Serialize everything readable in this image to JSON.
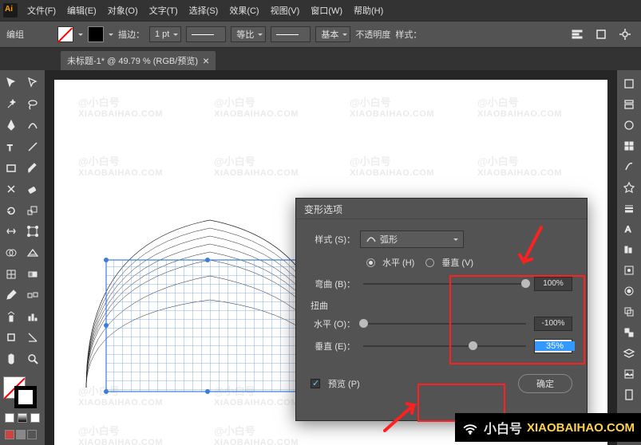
{
  "menu": {
    "file": "文件(F)",
    "edit": "编辑(E)",
    "object": "对象(O)",
    "type": "文字(T)",
    "select": "选择(S)",
    "effect": "效果(C)",
    "view": "视图(V)",
    "window": "窗口(W)",
    "help": "帮助(H)"
  },
  "control": {
    "group_label": "编组",
    "stroke_label": "描边：",
    "stroke_val": "1 pt",
    "dash1": "等比",
    "dash2": "基本",
    "opacity_label": "不透明度",
    "style_label": "样式："
  },
  "tab": {
    "title": "未标题-1* @ 49.79 % (RGB/预览)",
    "close": "×"
  },
  "dialog": {
    "title": "变形选项",
    "style_label": "样式 (S)：",
    "style_value": "弧形",
    "h_label": "水平 (H)",
    "v_label": "垂直 (V)",
    "bend_label": "弯曲 (B)：",
    "bend_val": "100%",
    "distort_label": "扭曲",
    "ho_label": "水平 (O)：",
    "ho_val": "-100%",
    "ve_label": "垂直 (E)：",
    "ve_val": "35%",
    "preview_label": "预览 (P)",
    "ok_label": "确定"
  },
  "watermark": {
    "name": "@小白号",
    "url": "XIAOBAIHAO.COM"
  },
  "brand": {
    "cn": "小白号",
    "url": "XIAOBAIHAO.COM"
  }
}
